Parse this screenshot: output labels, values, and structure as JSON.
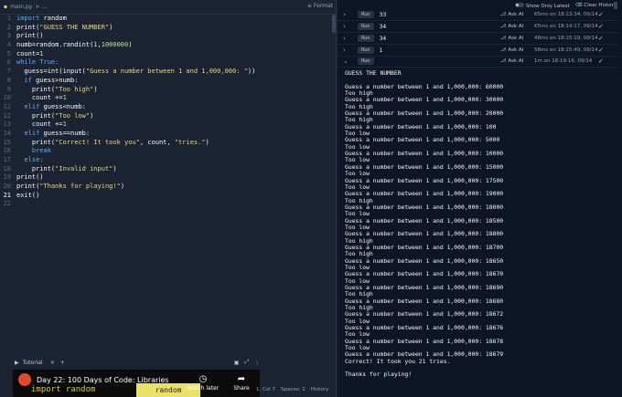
{
  "editor": {
    "filename": "main.py",
    "breadcrumb": "> ...",
    "format_label": "Format",
    "lines": [
      [
        [
          "import",
          "kw"
        ],
        [
          " random",
          "fn"
        ]
      ],
      [
        [
          "print(",
          "fn"
        ],
        [
          "\"GUESS THE NUMBER\"",
          "str"
        ],
        [
          ")",
          "fn"
        ]
      ],
      [
        [
          "print()",
          "fn"
        ]
      ],
      [
        [
          "numb=random.randint(",
          "fn"
        ],
        [
          "1",
          "num"
        ],
        [
          ",",
          "fn"
        ],
        [
          "1000000",
          "num"
        ],
        [
          ")",
          "fn"
        ]
      ],
      [
        [
          "count=",
          "fn"
        ],
        [
          "1",
          "num"
        ]
      ],
      [
        [
          "while",
          "kw"
        ],
        [
          " True:",
          "kw"
        ]
      ],
      [
        [
          "  guess=int(input(",
          "fn"
        ],
        [
          "\"Guess a number between 1 and 1,000,000: \"",
          "str"
        ],
        [
          "))",
          "fn"
        ]
      ],
      [
        [
          "  ",
          "fn"
        ],
        [
          "if",
          "kw"
        ],
        [
          " guess>numb:",
          "fn"
        ]
      ],
      [
        [
          "    print(",
          "fn"
        ],
        [
          "\"Too high\"",
          "str"
        ],
        [
          ")",
          "fn"
        ]
      ],
      [
        [
          "    count +=",
          "fn"
        ],
        [
          "1",
          "num"
        ]
      ],
      [
        [
          "  ",
          "fn"
        ],
        [
          "elif",
          "kw"
        ],
        [
          " guess<numb:",
          "fn"
        ]
      ],
      [
        [
          "    print(",
          "fn"
        ],
        [
          "\"Too low\"",
          "str"
        ],
        [
          ")",
          "fn"
        ]
      ],
      [
        [
          "    count +=",
          "fn"
        ],
        [
          "1",
          "num"
        ]
      ],
      [
        [
          "  ",
          "fn"
        ],
        [
          "elif",
          "kw"
        ],
        [
          " guess==numb:",
          "fn"
        ]
      ],
      [
        [
          "    print(",
          "fn"
        ],
        [
          "\"Correct! It took you\"",
          "str"
        ],
        [
          ", count, ",
          "fn"
        ],
        [
          "\"tries.\"",
          "str"
        ],
        [
          ")",
          "fn"
        ]
      ],
      [
        [
          "    ",
          "fn"
        ],
        [
          "break",
          "kw"
        ]
      ],
      [
        [
          "  ",
          "fn"
        ],
        [
          "else:",
          "kw"
        ]
      ],
      [
        [
          "    print(",
          "fn"
        ],
        [
          "\"Invalid input\"",
          "str"
        ],
        [
          ")",
          "fn"
        ]
      ],
      [
        [
          "print()",
          "fn"
        ]
      ],
      [
        [
          "print(",
          "fn"
        ],
        [
          "\"Thanks for playing!\"",
          "str"
        ],
        [
          ")",
          "fn"
        ]
      ],
      [
        [
          "exit()",
          "fn"
        ]
      ],
      []
    ],
    "current_line": 21
  },
  "tutorial": {
    "tab_label": "Tutorial",
    "video_title": "Day 22: 100 Days of Code: Libraries",
    "thumb_code": "import random",
    "thumb_highlight": "random",
    "watch_later": "Watch later",
    "share": "Share"
  },
  "status": {
    "position": "1, Col 7",
    "spaces": "Spaces: 2",
    "history": "History"
  },
  "console": {
    "show_only_latest": "Show Only Latest",
    "clear_history": "Clear History",
    "runs": [
      {
        "chev": "›",
        "tag": "Run",
        "value": "33",
        "ask": "Ask AI",
        "time": "65ms on 18:13:34, 09/14"
      },
      {
        "chev": "›",
        "tag": "Run",
        "value": "34",
        "ask": "Ask AI",
        "time": "65ms on 18:14:17, 09/14"
      },
      {
        "chev": "›",
        "tag": "Run",
        "value": "34",
        "ask": "Ask AI",
        "time": "48ms on 18:15:19, 09/14"
      },
      {
        "chev": "›",
        "tag": "Run",
        "value": "1",
        "ask": "Ask AI",
        "time": "58ms on 18:15:49, 09/14"
      },
      {
        "chev": "⌄",
        "tag": "Run",
        "value": "",
        "ask": "Ask AI",
        "time": "1m on 18:19:16, 09/14"
      }
    ],
    "output": [
      "GUESS THE NUMBER",
      "",
      "Guess a number between 1 and 1,000,000: 60000",
      "Too high",
      "Guess a number between 1 and 1,000,000: 30000",
      "Too high",
      "Guess a number between 1 and 1,000,000: 20000",
      "Too high",
      "Guess a number between 1 and 1,000,000: 100",
      "Too low",
      "Guess a number between 1 and 1,000,000: 5000",
      "Too low",
      "Guess a number between 1 and 1,000,000: 10000",
      "Too low",
      "Guess a number between 1 and 1,000,000: 15000",
      "Too low",
      "Guess a number between 1 and 1,000,000: 17500",
      "Too low",
      "Guess a number between 1 and 1,000,000: 19000",
      "Too high",
      "Guess a number between 1 and 1,000,000: 18000",
      "Too low",
      "Guess a number between 1 and 1,000,000: 18500",
      "Too low",
      "Guess a number between 1 and 1,000,000: 18800",
      "Too high",
      "Guess a number between 1 and 1,000,000: 18700",
      "Too high",
      "Guess a number between 1 and 1,000,000: 18650",
      "Too low",
      "Guess a number between 1 and 1,000,000: 18670",
      "Too low",
      "Guess a number between 1 and 1,000,000: 18690",
      "Too high",
      "Guess a number between 1 and 1,000,000: 18680",
      "Too high",
      "Guess a number between 1 and 1,000,000: 18672",
      "Too low",
      "Guess a number between 1 and 1,000,000: 18676",
      "Too low",
      "Guess a number between 1 and 1,000,000: 18678",
      "Too low",
      "Guess a number between 1 and 1,000,000: 18679",
      "Correct! It took you 21 tries.",
      "",
      "Thanks for playing!"
    ]
  }
}
